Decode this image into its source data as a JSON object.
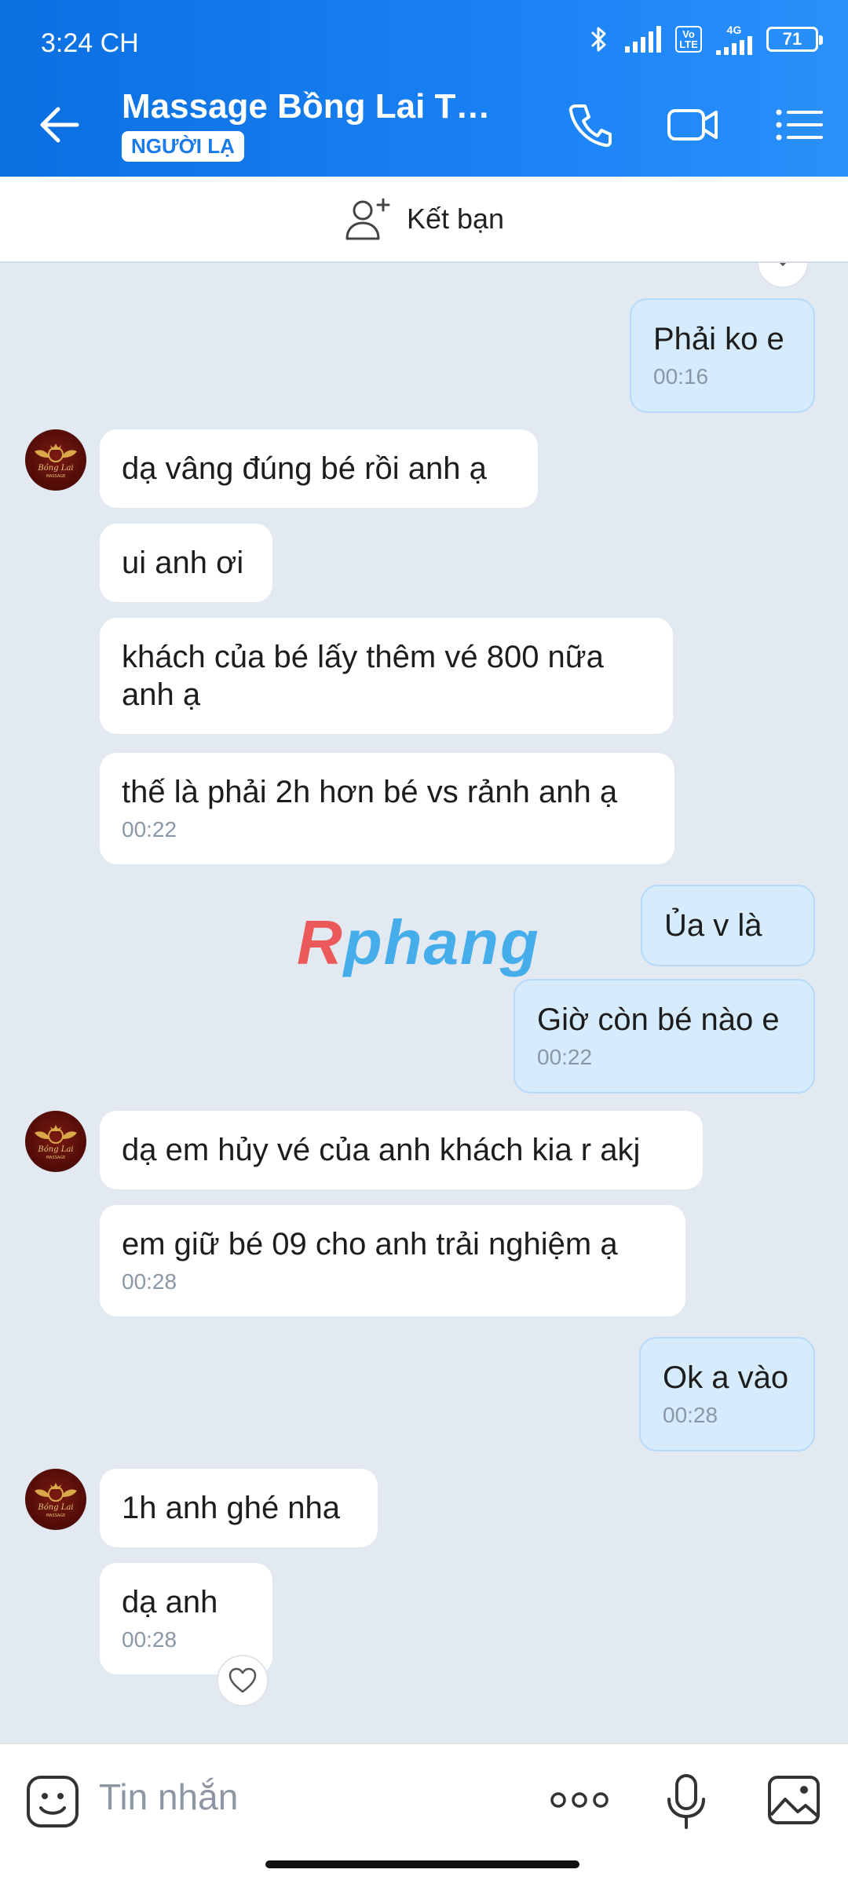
{
  "status": {
    "time": "3:24 CH",
    "volte": "Vo LTE",
    "net": "4G",
    "battery": "71"
  },
  "header": {
    "title": "Massage Bồng Lai Thủ...",
    "badge": "NGƯỜI LẠ"
  },
  "friend_bar": {
    "label": "Kết bạn"
  },
  "avatar": {
    "logo_text": "Bồng Lai MASSAGE"
  },
  "messages": [
    {
      "dir": "out",
      "text": "Phải ko e",
      "time": "00:16"
    },
    {
      "dir": "in",
      "text": "dạ vâng đúng bé rồi anh ạ"
    },
    {
      "dir": "in",
      "text": "ui anh ơi"
    },
    {
      "dir": "in",
      "text": "khách của bé lấy thêm vé 800 nữa anh ạ"
    },
    {
      "dir": "in",
      "text": "thế là phải 2h hơn bé vs rảnh anh ạ",
      "time": "00:22"
    },
    {
      "dir": "out",
      "text": "Ủa v là"
    },
    {
      "dir": "out",
      "text": "Giờ còn bé nào e",
      "time": "00:22"
    },
    {
      "dir": "in",
      "text": "dạ em hủy vé của anh khách kia r akj"
    },
    {
      "dir": "in",
      "text": "em giữ bé 09 cho anh trải nghiệm ạ",
      "time": "00:28"
    },
    {
      "dir": "out",
      "text": "Ok a vào",
      "time": "00:28"
    },
    {
      "dir": "in",
      "text": "1h anh ghé nha"
    },
    {
      "dir": "in",
      "text": "dạ anh",
      "time": "00:28"
    }
  ],
  "watermark": {
    "part1": "R",
    "part2": "phang"
  },
  "composer": {
    "placeholder": "Tin nhắn"
  },
  "colors": {
    "header": "#1a82f5",
    "incoming": "#ffffff",
    "outgoing": "#d6ecfd",
    "chat_bg": "#e2e9f1"
  },
  "icons": [
    "back-arrow-icon",
    "phone-icon",
    "video-call-icon",
    "menu-list-icon",
    "add-friend-icon",
    "emoji-icon",
    "more-dots-icon",
    "microphone-icon",
    "image-icon",
    "heart-icon",
    "bluetooth-icon",
    "signal-icon",
    "battery-icon"
  ]
}
